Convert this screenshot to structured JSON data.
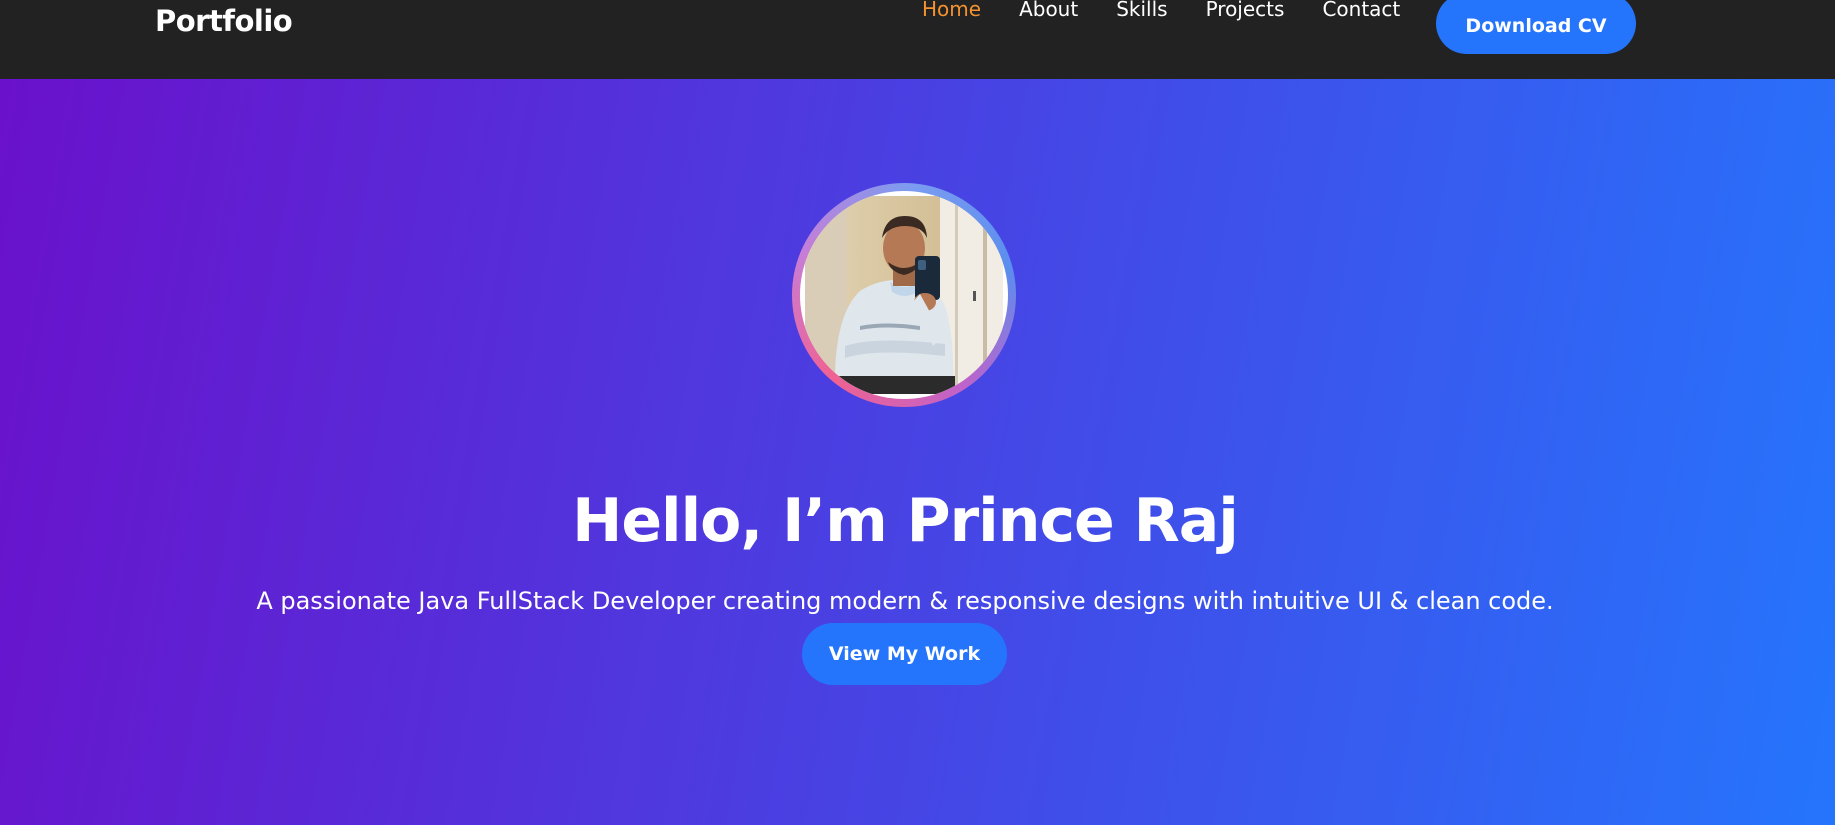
{
  "nav": {
    "brand": "Portfolio",
    "links": [
      "Home",
      "About",
      "Skills",
      "Projects",
      "Contact"
    ],
    "active_link": "Home",
    "cta_label": "Download CV"
  },
  "hero": {
    "title": "Hello, I’m Prince Raj",
    "subtitle": "A passionate Java FullStack Developer creating modern & responsive designs with intuitive UI & clean code.",
    "cta_label": "View My Work",
    "gradient_start": "#6a11cb",
    "gradient_end": "#2575fc"
  },
  "colors": {
    "navbar_bg": "#222222",
    "accent": "#2575fc",
    "active_link": "#f39230"
  }
}
